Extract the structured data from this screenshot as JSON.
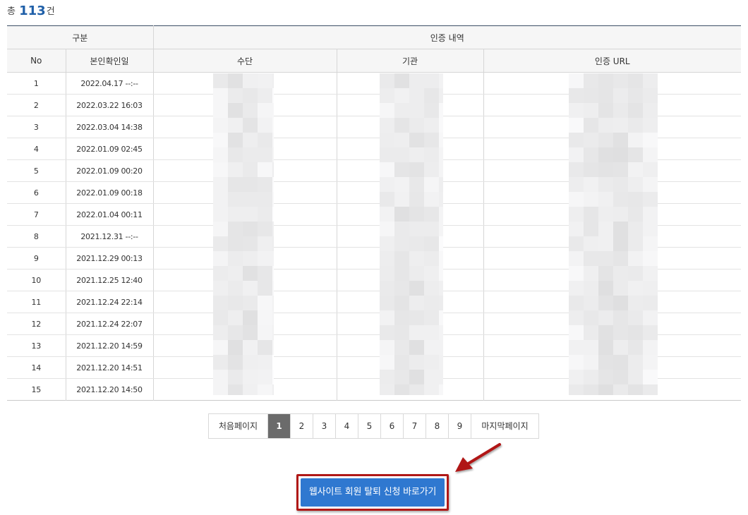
{
  "summary": {
    "prefix": "총",
    "count": "113",
    "suffix": "건"
  },
  "table": {
    "group_headers": {
      "category": "구분",
      "auth_history": "인증 내역"
    },
    "columns": {
      "no": "No",
      "date": "본인확인일",
      "method": "수단",
      "agency": "기관",
      "url": "인증 URL"
    },
    "rows": [
      {
        "no": "1",
        "date": "2022.04.17 --:--"
      },
      {
        "no": "2",
        "date": "2022.03.22 16:03"
      },
      {
        "no": "3",
        "date": "2022.03.04 14:38"
      },
      {
        "no": "4",
        "date": "2022.01.09 02:45"
      },
      {
        "no": "5",
        "date": "2022.01.09 00:20"
      },
      {
        "no": "6",
        "date": "2022.01.09 00:18"
      },
      {
        "no": "7",
        "date": "2022.01.04 00:11"
      },
      {
        "no": "8",
        "date": "2021.12.31 --:--"
      },
      {
        "no": "9",
        "date": "2021.12.29 00:13"
      },
      {
        "no": "10",
        "date": "2021.12.25 12:40"
      },
      {
        "no": "11",
        "date": "2021.12.24 22:14"
      },
      {
        "no": "12",
        "date": "2021.12.24 22:07"
      },
      {
        "no": "13",
        "date": "2021.12.20 14:59"
      },
      {
        "no": "14",
        "date": "2021.12.20 14:51"
      },
      {
        "no": "15",
        "date": "2021.12.20 14:50"
      }
    ]
  },
  "pagination": {
    "first_label": "처음페이지",
    "last_label": "마지막페이지",
    "pages": [
      "1",
      "2",
      "3",
      "4",
      "5",
      "6",
      "7",
      "8",
      "9"
    ],
    "current": "1"
  },
  "cta": {
    "label": "웹사이트 회원 탈퇴 신청 바로가기"
  },
  "colors": {
    "accent": "#1f5fa8",
    "button": "#2f78d0",
    "highlight_frame": "#b01817",
    "active_page": "#6b6b6b"
  }
}
